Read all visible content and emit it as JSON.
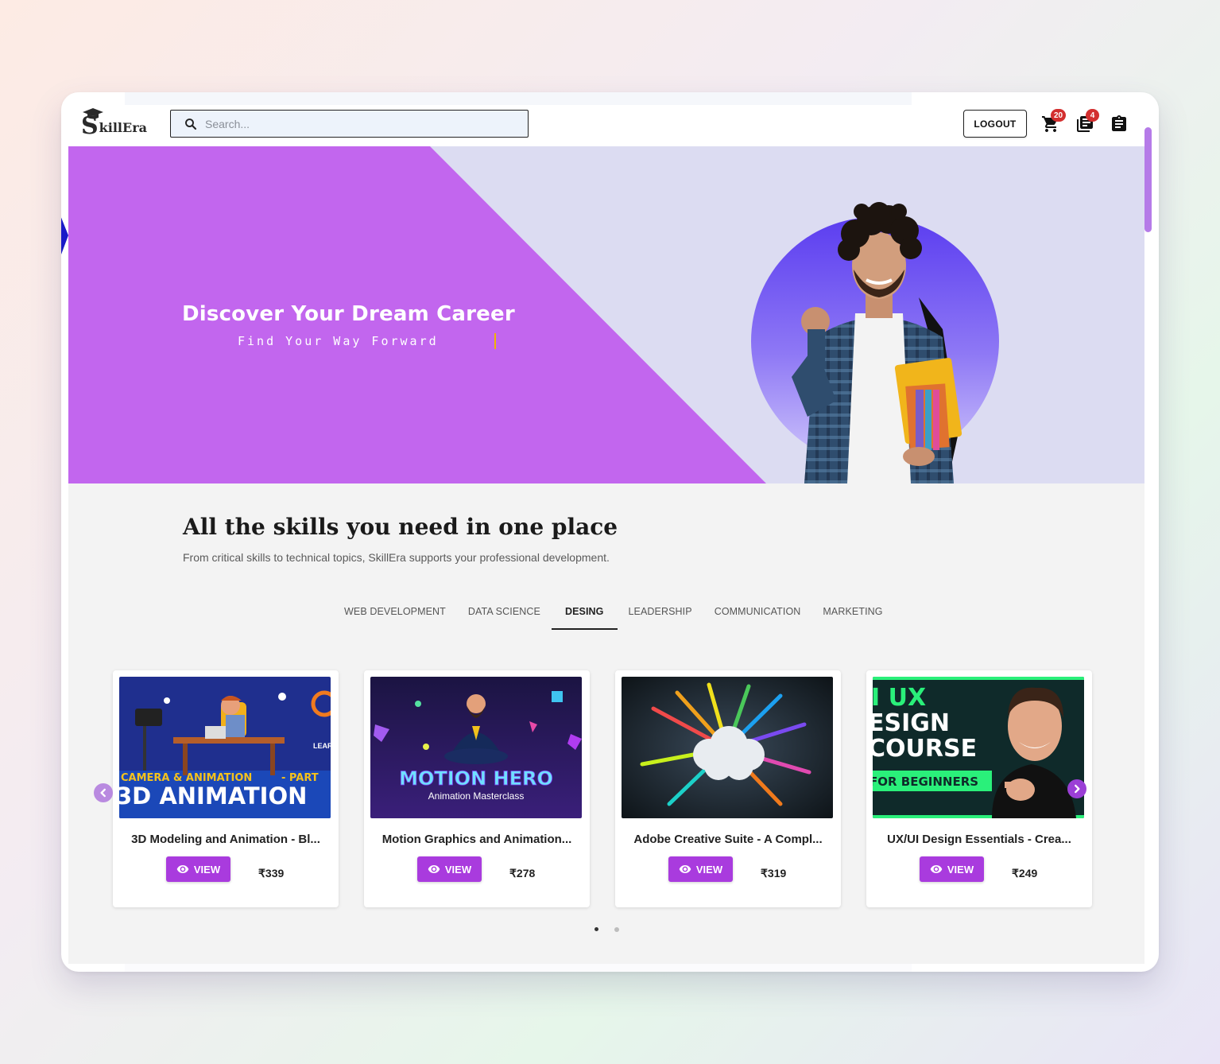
{
  "brand": {
    "logo_initial": "S",
    "logo_rest": "killEra"
  },
  "search": {
    "placeholder": "Search..."
  },
  "navbar": {
    "logout_label": "LOGOUT",
    "cart_count": "20",
    "library_count": "4"
  },
  "hero": {
    "title": "Discover Your Dream Career",
    "subtitle": "Find Your Way Forward"
  },
  "section": {
    "title": "All the skills you need in one place",
    "subtitle": "From critical skills to technical topics, SkillEra supports your professional development."
  },
  "tabs": [
    {
      "label": "WEB DEVELOPMENT"
    },
    {
      "label": "DATA SCIENCE"
    },
    {
      "label": "DESING",
      "active": true
    },
    {
      "label": "LEADERSHIP"
    },
    {
      "label": "COMMUNICATION"
    },
    {
      "label": "MARKETING"
    }
  ],
  "courses": [
    {
      "title": "3D Modeling and Animation - Bl...",
      "view_label": "VIEW",
      "price": "₹339",
      "thumb": {
        "line1": "CAMERA & ANIMATION",
        "line1b": "- PART",
        "line2": "3D ANIMATION",
        "side": "LEARN ANIMA"
      }
    },
    {
      "title": "Motion Graphics and Animation...",
      "view_label": "VIEW",
      "price": "₹278",
      "thumb": {
        "line1": "MOTION HERO",
        "line2": "Animation Masterclass"
      }
    },
    {
      "title": "Adobe Creative Suite - A Compl...",
      "view_label": "VIEW",
      "price": "₹319",
      "thumb": {}
    },
    {
      "title": "UX/UI Design Essentials - Crea...",
      "view_label": "VIEW",
      "price": "₹249",
      "thumb": {
        "line1": "I UX",
        "line2": "ESIGN",
        "line3": "COURSE",
        "line4": "FOR BEGINNERS"
      }
    }
  ],
  "carousel": {
    "page_count": 2,
    "active_page": 1
  },
  "colors": {
    "accent": "#a93bde",
    "hero_purple": "#c266ee",
    "hero_bg": "#dcdcf2",
    "badge": "#d32f2f"
  }
}
